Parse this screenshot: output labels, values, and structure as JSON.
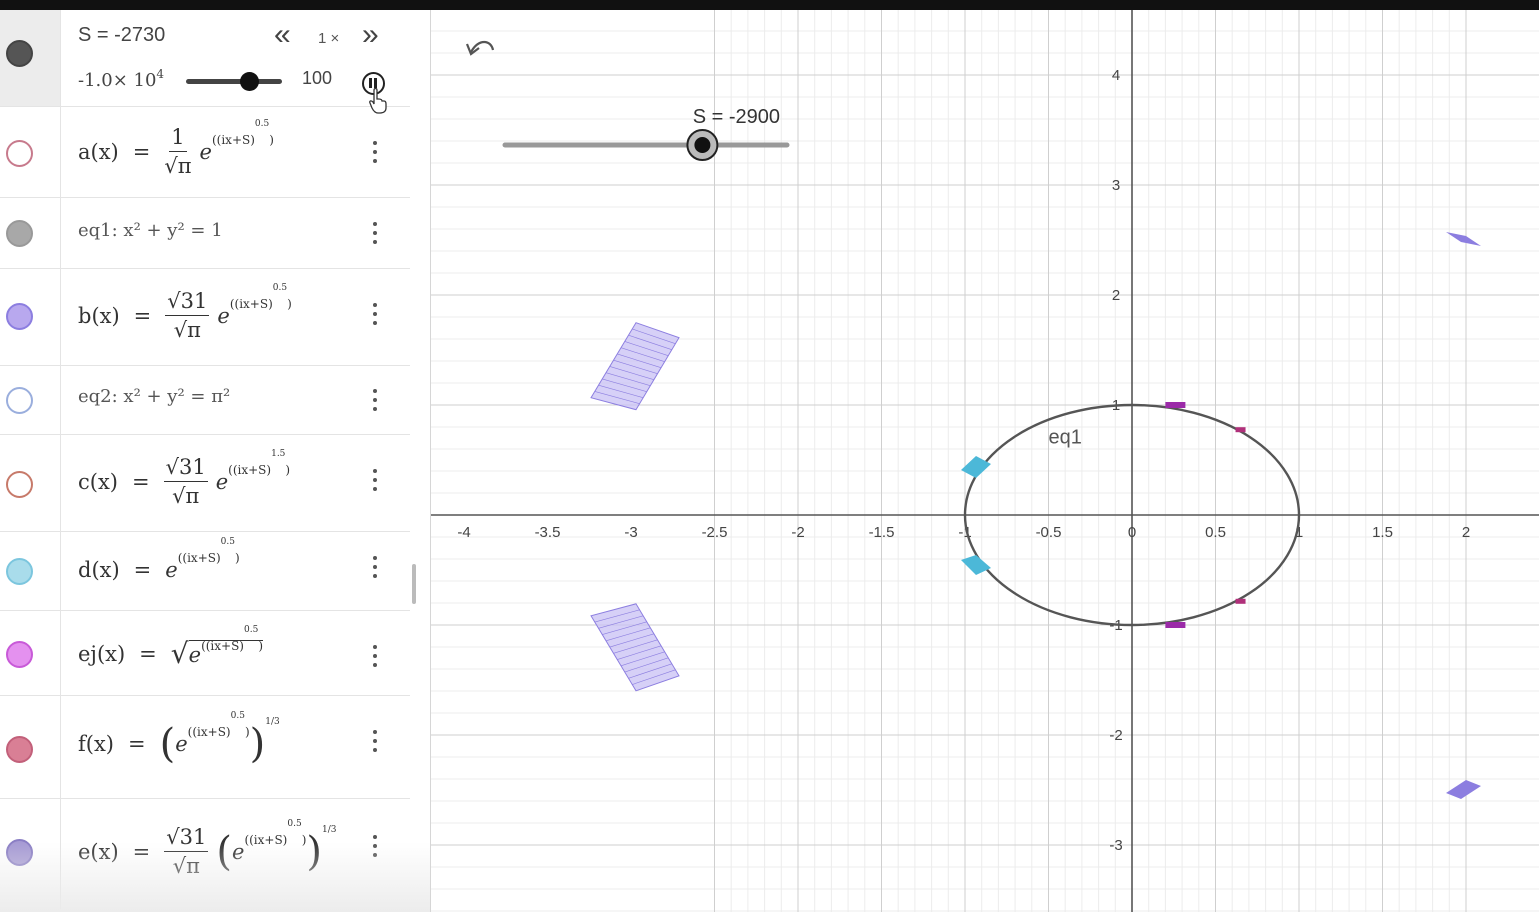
{
  "slider_panel": {
    "s_value_label": "S = -2730",
    "speed_label": "1 ×",
    "min_label": "-1.0× 10",
    "min_exp": "4",
    "max_label": "100",
    "slower_glyph": "«",
    "faster_glyph": "»",
    "pause_icon": "pause-icon"
  },
  "algebra_rows": [
    {
      "id": "a",
      "name": "a(x)",
      "eq": "=",
      "num": "1",
      "den": "√π",
      "base": "e",
      "exp": "((ix+S)",
      "exp2": "0.5",
      "color": "#c77a8c",
      "filled": false
    },
    {
      "id": "eq1",
      "text": "eq1: x² + y² = 1",
      "color": "#a8a8a8",
      "filled": true
    },
    {
      "id": "b",
      "name": "b(x)",
      "eq": "=",
      "num": "√31",
      "den": "√π",
      "base": "e",
      "exp": "((ix+S)",
      "exp2": "0.5",
      "color": "#b8a8ee",
      "filled": true
    },
    {
      "id": "eq2",
      "text": "eq2: x² + y² = π²",
      "color": "#9aaedd",
      "filled": false
    },
    {
      "id": "c",
      "name": "c(x)",
      "eq": "=",
      "num": "√31",
      "den": "√π",
      "base": "e",
      "exp": "((ix+S)",
      "exp2": "1.5",
      "color": "#c77a6a",
      "filled": false
    },
    {
      "id": "d",
      "name": "d(x)",
      "eq": "=",
      "base": "e",
      "exp": "((ix+S)",
      "exp2": "0.5",
      "color": "#a9dceb",
      "filled": true
    },
    {
      "id": "ej",
      "name": "ej(x)",
      "eq": "=",
      "radical": "√",
      "base": "e",
      "exp": "((ix+S)",
      "exp2": "0.5",
      "color": "#e491ef",
      "filled": true
    },
    {
      "id": "f",
      "name": "f(x)",
      "eq": "=",
      "base": "e",
      "exp": "((ix+S)",
      "exp2": "0.5",
      "outer_exp": "1/3",
      "color": "#d97f95",
      "filled": true
    },
    {
      "id": "e",
      "name": "e(x)",
      "eq": "=",
      "num": "√31",
      "den": "√π",
      "base": "e",
      "exp": "((ix+S)",
      "exp2": "0.5",
      "outer_exp": "1/3",
      "color": "#a69ad4",
      "filled": true
    }
  ],
  "graph": {
    "undo_icon": "undo-icon",
    "slider_label": "S = -2900",
    "slider_fraction": 0.7,
    "curve_label": "eq1",
    "x_ticks": [
      "-4",
      "-3.5",
      "-3",
      "-2.5",
      "-2",
      "-1.5",
      "-1",
      "-0.5",
      "0",
      "0.5",
      "1",
      "1.5",
      "2"
    ],
    "y_ticks": [
      "4",
      "3",
      "2",
      "1",
      "-1",
      "-2",
      "-3"
    ],
    "colors": {
      "grid_minor": "#ececec",
      "grid_major": "#cfcfcf",
      "axis": "#555",
      "circle": "#555",
      "violet": "#8c7ee0",
      "cyan": "#4cb8d8",
      "magenta": "#9b2aa8"
    }
  }
}
